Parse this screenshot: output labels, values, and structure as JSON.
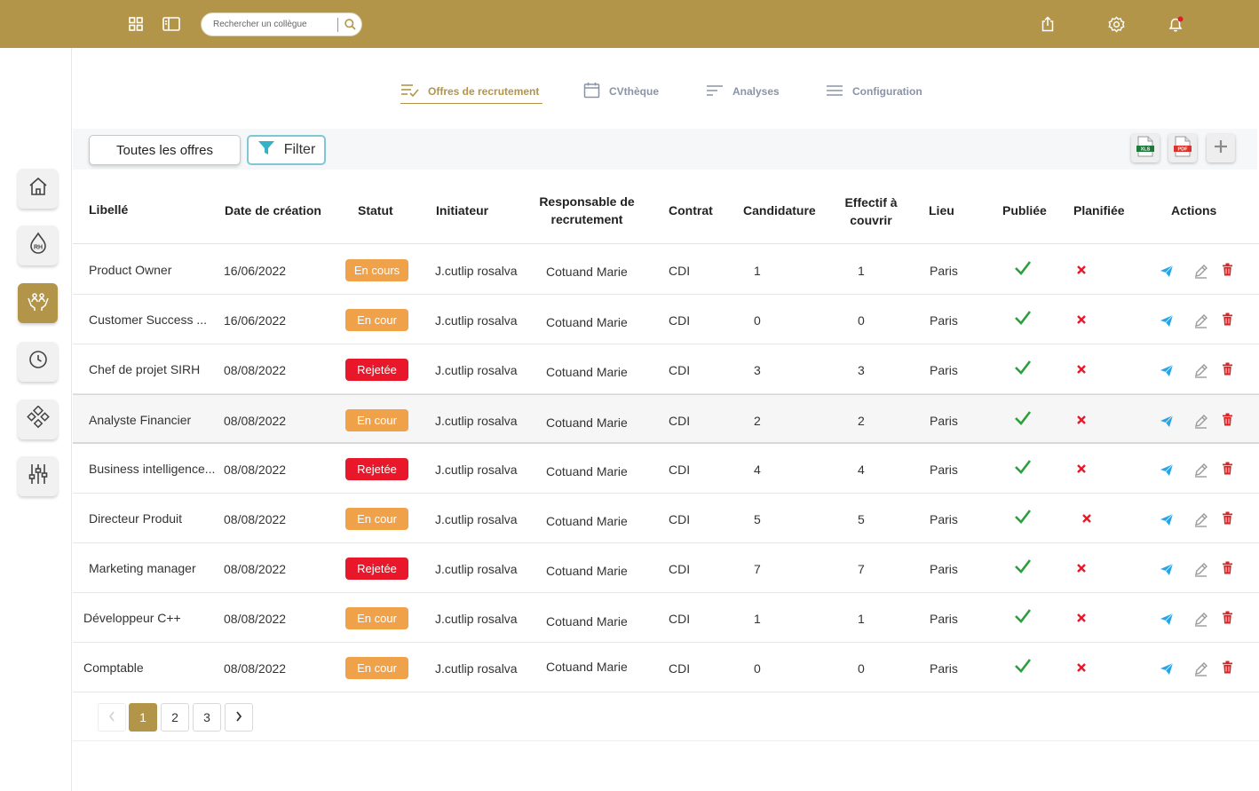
{
  "topbar": {
    "search_placeholder": "Rechercher un collègue",
    "icons": [
      "grid-icon",
      "sidebar-toggle-icon",
      "search-icon",
      "share-icon",
      "settings-icon",
      "notification-icon"
    ]
  },
  "sidebar": {
    "items": [
      {
        "name": "home",
        "icon": "home-icon",
        "active": false
      },
      {
        "name": "rh",
        "icon": "rh-drop-icon",
        "active": false
      },
      {
        "name": "recrutement",
        "icon": "hands-people-icon",
        "active": true
      },
      {
        "name": "temps",
        "icon": "clock-icon",
        "active": false
      },
      {
        "name": "organisation",
        "icon": "network-icon",
        "active": false
      },
      {
        "name": "parametres",
        "icon": "sliders-icon",
        "active": false
      }
    ]
  },
  "tabs": [
    {
      "label": "Offres de recrutement",
      "active": true
    },
    {
      "label": "CVthèque",
      "active": false
    },
    {
      "label": "Analyses",
      "active": false
    },
    {
      "label": "Configuration",
      "active": false
    }
  ],
  "toolbar": {
    "all_offers_label": "Toutes les offres",
    "filter_label": "Filter",
    "export_xls_label": "XLS",
    "export_pdf_label": "PDF"
  },
  "table": {
    "headers": {
      "libelle": "Libellé",
      "date": "Date de création",
      "statut": "Statut",
      "initiateur": "Initiateur",
      "responsable_1": "Responsable de",
      "responsable_2": "recrutement",
      "contrat": "Contrat",
      "candidature": "Candidature",
      "effectif_1": "Effectif à",
      "effectif_2": "couvrir",
      "lieu": "Lieu",
      "publiee": "Publiée",
      "planifiee": "Planifiée",
      "actions": "Actions"
    },
    "rows": [
      {
        "libelle": "Product Owner",
        "date": "16/06/2022",
        "statut": "En cours",
        "statut_color": "orange",
        "initiateur": "J.cutlip rosalva",
        "responsable": "Cotuand Marie",
        "contrat": "CDI",
        "candidature": "1",
        "effectif": "1",
        "lieu": "Paris",
        "publiee": true,
        "planifiee": false
      },
      {
        "libelle": "Customer Success ...",
        "date": "16/06/2022",
        "statut": "En cour",
        "statut_color": "orange",
        "initiateur": "J.cutlip rosalva",
        "responsable": "Cotuand Marie",
        "contrat": "CDI",
        "candidature": "0",
        "effectif": "0",
        "lieu": "Paris",
        "publiee": true,
        "planifiee": false
      },
      {
        "libelle": "Chef de projet SIRH",
        "date": "08/08/2022",
        "statut": "Rejetée",
        "statut_color": "red",
        "initiateur": "J.cutlip rosalva",
        "responsable": "Cotuand Marie",
        "contrat": "CDI",
        "candidature": "3",
        "effectif": "3",
        "lieu": "Paris",
        "publiee": true,
        "planifiee": false
      },
      {
        "libelle": "Analyste Financier",
        "date": "08/08/2022",
        "statut": "En cour",
        "statut_color": "orange",
        "initiateur": "J.cutlip rosalva",
        "responsable": "Cotuand Marie",
        "contrat": "CDI",
        "candidature": "2",
        "effectif": "2",
        "lieu": "Paris",
        "publiee": true,
        "planifiee": false
      },
      {
        "libelle": "Business intelligence...",
        "date": "08/08/2022",
        "statut": "Rejetée",
        "statut_color": "red",
        "initiateur": "J.cutlip rosalva",
        "responsable": "Cotuand Marie",
        "contrat": "CDI",
        "candidature": "4",
        "effectif": "4",
        "lieu": "Paris",
        "publiee": true,
        "planifiee": false
      },
      {
        "libelle": "Directeur Produit",
        "date": "08/08/2022",
        "statut": "En cour",
        "statut_color": "orange",
        "initiateur": "J.cutlip rosalva",
        "responsable": "Cotuand Marie",
        "contrat": "CDI",
        "candidature": "5",
        "effectif": "5",
        "lieu": "Paris",
        "publiee": true,
        "planifiee": false
      },
      {
        "libelle": "Marketing manager",
        "date": "08/08/2022",
        "statut": "Rejetée",
        "statut_color": "red",
        "initiateur": "J.cutlip rosalva",
        "responsable": "Cotuand Marie",
        "contrat": "CDI",
        "candidature": "7",
        "effectif": "7",
        "lieu": "Paris",
        "publiee": true,
        "planifiee": false
      },
      {
        "libelle": "Développeur C++",
        "date": "08/08/2022",
        "statut": "En cour",
        "statut_color": "orange",
        "initiateur": "J.cutlip rosalva",
        "responsable": "Cotuand Marie",
        "contrat": "CDI",
        "candidature": "1",
        "effectif": "1",
        "lieu": "Paris",
        "publiee": true,
        "planifiee": false
      },
      {
        "libelle": "Comptable",
        "date": "08/08/2022",
        "statut": "En cour",
        "statut_color": "orange",
        "initiateur": "J.cutlip rosalva",
        "responsable": "Cotuand Marie",
        "contrat": "CDI",
        "candidature": "0",
        "effectif": "0",
        "lieu": "Paris",
        "publiee": true,
        "planifiee": false
      }
    ]
  },
  "pagination": {
    "pages": [
      "1",
      "2",
      "3"
    ],
    "current": "1"
  },
  "colors": {
    "brand": "#b3954a",
    "status_orange": "#f0a24a",
    "status_red": "#e8182a",
    "check_green": "#2e9e3c",
    "send_blue": "#2aa4e6",
    "delete_red": "#e02020"
  }
}
